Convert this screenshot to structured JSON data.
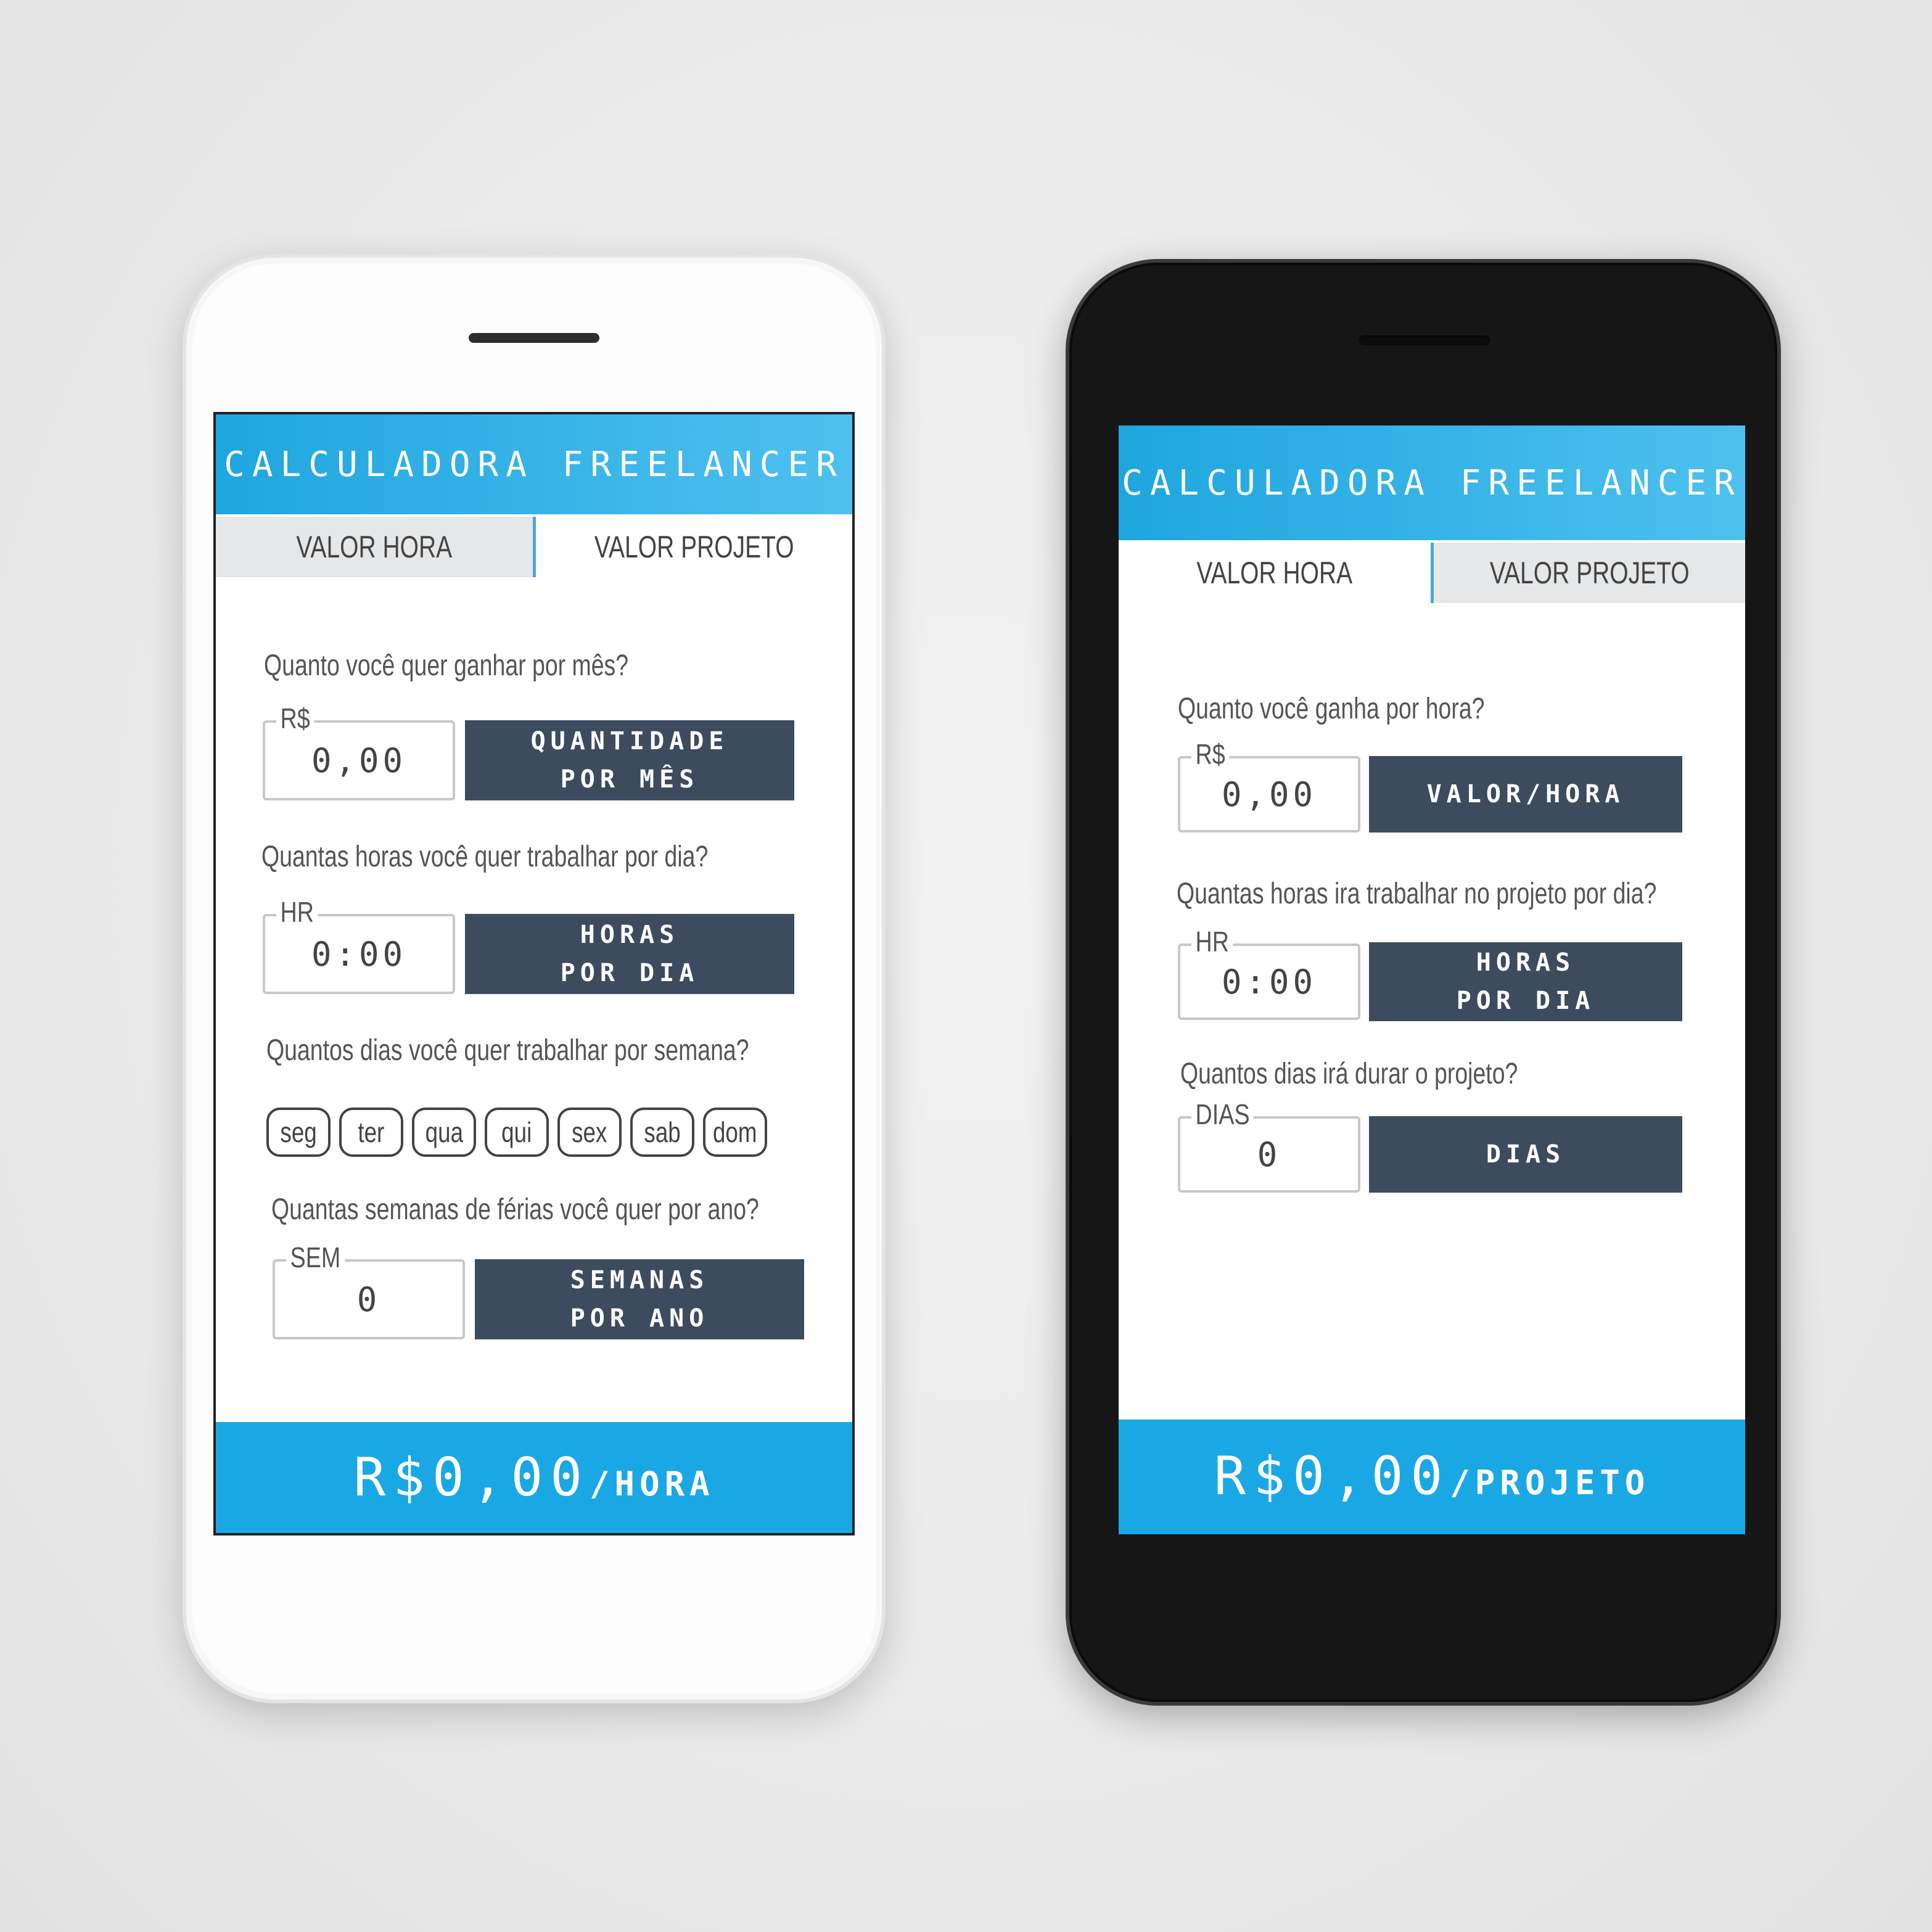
{
  "app": {
    "title": "CALCULADORA FREELANCER"
  },
  "phone_hourly": {
    "tabs": [
      "VALOR HORA",
      "VALOR PROJETO"
    ],
    "q1": {
      "question": "Quanto você quer ganhar por mês?",
      "legend": "R$",
      "value": "0,00",
      "button_line1": "QUANTIDADE",
      "button_line2": "POR MÊS"
    },
    "q2": {
      "question": "Quantas horas você quer trabalhar por dia?",
      "legend": "HR",
      "value": "0:00",
      "button_line1": "HORAS",
      "button_line2": "POR DIA"
    },
    "q3": {
      "question": "Quantos dias você quer trabalhar por semana?",
      "days": [
        "seg",
        "ter",
        "qua",
        "qui",
        "sex",
        "sab",
        "dom"
      ]
    },
    "q4": {
      "question": "Quantas semanas de férias você quer por ano?",
      "legend": "SEM",
      "value": "0",
      "button_line1": "SEMANAS",
      "button_line2": "POR ANO"
    },
    "result": {
      "amount": "R$0,00",
      "unit": "/HORA"
    }
  },
  "phone_project": {
    "tabs": [
      "VALOR HORA",
      "VALOR PROJETO"
    ],
    "q1": {
      "question": "Quanto você ganha por hora?",
      "legend": "R$",
      "value": "0,00",
      "button_line1": "VALOR/HORA"
    },
    "q2": {
      "question": "Quantas horas ira trabalhar no projeto por dia?",
      "legend": "HR",
      "value": "0:00",
      "button_line1": "HORAS",
      "button_line2": "POR DIA"
    },
    "q3": {
      "question": "Quantos dias irá durar o projeto?",
      "legend": "DIAS",
      "value": "0",
      "button_line1": "DIAS"
    },
    "result": {
      "amount": "R$0,00",
      "unit": "/PROJETO"
    }
  }
}
